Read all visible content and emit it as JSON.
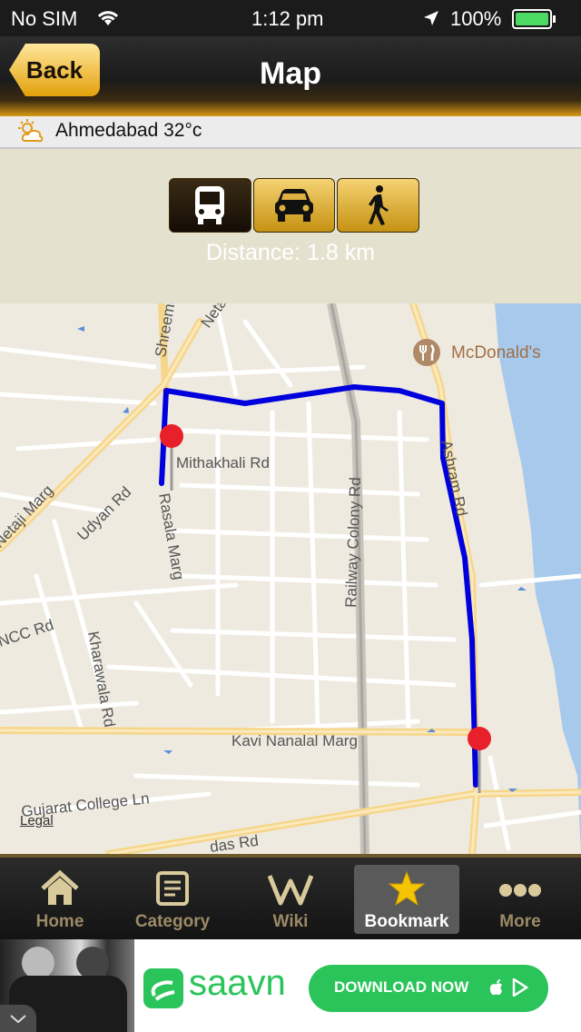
{
  "status_bar": {
    "carrier": "No SIM",
    "time": "1:12 pm",
    "battery": "100%"
  },
  "nav": {
    "back_label": "Back",
    "title": "Map"
  },
  "weather": {
    "text": "Ahmedabad 32°c"
  },
  "transport": {
    "modes": [
      "bus",
      "car",
      "walk"
    ],
    "selected": "bus",
    "distance": "Distance: 1.8 km"
  },
  "map": {
    "labels": {
      "mcdonalds": "McDonald's",
      "shreemali": "Shreema",
      "netaji_top": "Neta",
      "mithakhali": "Mithakhali Rd",
      "railway": "Railway Colony Rd",
      "ashram": "Ashram Rd",
      "udyan": "Udyan Rd",
      "rasala": "Rasala Marg",
      "netaji_marg": "Netaji Marg",
      "ncc": "NCC Rd",
      "kharawala": "Kharawala Rd",
      "kavi": "Kavi Nanalal Marg",
      "gujarat": "Gujarat College Ln",
      "das": "das Rd"
    },
    "legal": "Legal",
    "route_color": "#0000dd",
    "marker_color": "#e8202a"
  },
  "tabs": [
    {
      "label": "Home",
      "icon": "home-icon"
    },
    {
      "label": "Category",
      "icon": "notepad-icon"
    },
    {
      "label": "Wiki",
      "icon": "wikipedia-icon"
    },
    {
      "label": "Bookmark",
      "icon": "star-icon"
    },
    {
      "label": "More",
      "icon": "more-dots-icon"
    }
  ],
  "active_tab": "Bookmark",
  "ad": {
    "brand": "saavn",
    "cta": "DOWNLOAD NOW"
  },
  "colors": {
    "accent": "#e3a10c",
    "tab_active_bg": "#5a5a5a",
    "saavn_green": "#2bc45a"
  }
}
